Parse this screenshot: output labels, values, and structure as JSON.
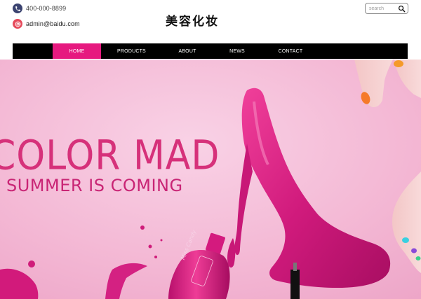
{
  "contact": {
    "phone": "400-000-8899",
    "email": "admin@baidu.com"
  },
  "brand": {
    "logo_text": "美容化妆"
  },
  "search": {
    "placeholder": "search"
  },
  "nav": {
    "items": [
      {
        "label": "HOME",
        "active": true
      },
      {
        "label": "PRODUCTS",
        "active": false
      },
      {
        "label": "ABOUT",
        "active": false
      },
      {
        "label": "NEWS",
        "active": false
      },
      {
        "label": "CONTACT",
        "active": false
      }
    ]
  },
  "banner": {
    "headline": "COLOR MAD",
    "subheadline": "SUMMER IS COMING",
    "bottle_label": "Miss Candy"
  },
  "icons": {
    "phone": "phone-icon",
    "email": "at-sign-icon",
    "search": "search-icon"
  },
  "colors": {
    "accent": "#e6197f",
    "nav_background": "#000000",
    "banner_background": "#f3b6d3",
    "headline": "#d6317a"
  }
}
